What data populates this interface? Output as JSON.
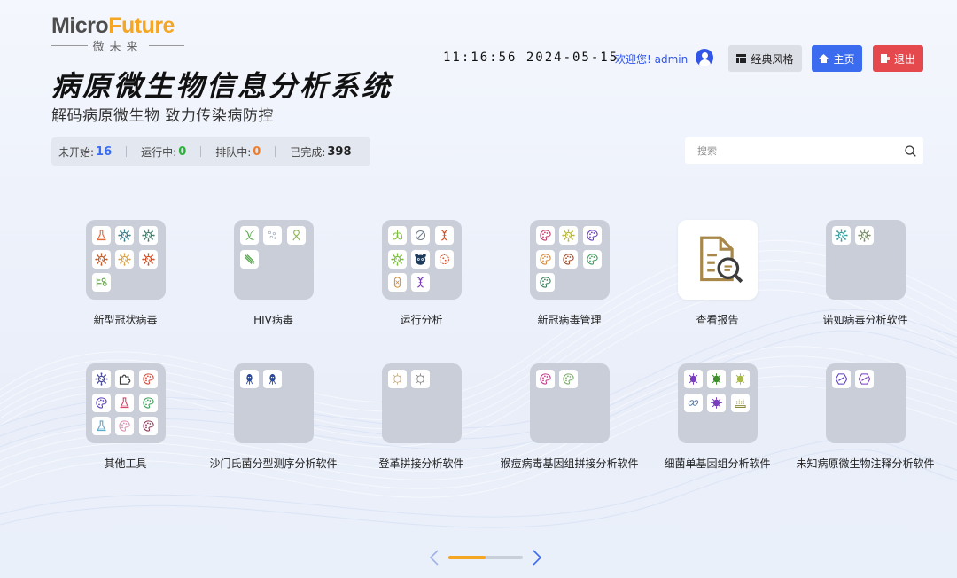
{
  "logo": {
    "brand_part1": "Micro",
    "brand_part2": "Future",
    "subtitle": "微未来"
  },
  "header": {
    "title": "病原微生物信息分析系统",
    "subtitle": "解码病原微生物 致力传染病防控",
    "clock": "11:16:56 2024-05-15",
    "welcome": "欢迎您! admin",
    "buttons": {
      "classic": "经典风格",
      "home": "主页",
      "logout": "退出"
    }
  },
  "status": [
    {
      "label": "未开始:",
      "value": "16",
      "color": "#3b6cf0"
    },
    {
      "label": "运行中:",
      "value": "0",
      "color": "#2bb13a"
    },
    {
      "label": "排队中:",
      "value": "0",
      "color": "#f07c2a"
    },
    {
      "label": "已完成:",
      "value": "398",
      "color": "#222222"
    }
  ],
  "search": {
    "placeholder": "搜索"
  },
  "apps": [
    {
      "label": "新型冠状病毒",
      "type": "folder",
      "icons": [
        {
          "icon": "flask-icon",
          "color": "#e0693c"
        },
        {
          "icon": "virus-icon",
          "color": "#3c7f8c"
        },
        {
          "icon": "virus-icon",
          "color": "#4a7f6b"
        },
        {
          "icon": "virus-icon",
          "color": "#c45c2a"
        },
        {
          "icon": "virus-icon",
          "color": "#d9a54a"
        },
        {
          "icon": "virus-icon",
          "color": "#d0502a"
        },
        {
          "icon": "dna-sample-icon",
          "color": "#6aa84f"
        }
      ]
    },
    {
      "label": "HIV病毒",
      "type": "folder",
      "icons": [
        {
          "icon": "strand-icon",
          "color": "#5aa84f"
        },
        {
          "icon": "dots-icon",
          "color": "#9aa3b8"
        },
        {
          "icon": "ribbon-icon",
          "color": "#8cb84f"
        },
        {
          "icon": "slash-icon",
          "color": "#5aa84f"
        }
      ]
    },
    {
      "label": "运行分析",
      "type": "folder",
      "icons": [
        {
          "icon": "lungs-icon",
          "color": "#7bbf3c"
        },
        {
          "icon": "pill-icon",
          "color": "#6f7b8c"
        },
        {
          "icon": "dna-icon",
          "color": "#d0502a"
        },
        {
          "icon": "virus-icon",
          "color": "#7bbf3c"
        },
        {
          "icon": "panda-icon",
          "color": "#1d3b5a"
        },
        {
          "icon": "cell-icon",
          "color": "#d0502a"
        },
        {
          "icon": "capsule-icon",
          "color": "#d28a3c"
        },
        {
          "icon": "dna-icon",
          "color": "#7b3cbf"
        }
      ]
    },
    {
      "label": "新冠病毒管理",
      "type": "folder",
      "icons": [
        {
          "icon": "palette-icon",
          "color": "#c23c6a"
        },
        {
          "icon": "virus-icon",
          "color": "#b9b93c"
        },
        {
          "icon": "palette-icon",
          "color": "#6a3cbf"
        },
        {
          "icon": "palette-icon",
          "color": "#d28a3c"
        },
        {
          "icon": "palette-icon",
          "color": "#a04a2a"
        },
        {
          "icon": "palette-icon",
          "color": "#3c9f5a"
        },
        {
          "icon": "palette-icon",
          "color": "#3c7f5a"
        }
      ]
    },
    {
      "label": "查看报告",
      "type": "single",
      "icons": [
        {
          "icon": "report-search-icon",
          "color": "#a8884a"
        }
      ]
    },
    {
      "label": "诺如病毒分析软件",
      "type": "folder",
      "icons": [
        {
          "icon": "virus-icon",
          "color": "#3c9f9f"
        },
        {
          "icon": "virus-icon",
          "color": "#7a8f6a"
        }
      ]
    },
    {
      "label": "其他工具",
      "type": "folder",
      "icons": [
        {
          "icon": "virus-icon",
          "color": "#4a4a9f"
        },
        {
          "icon": "puzzle-icon",
          "color": "#3c3c3c"
        },
        {
          "icon": "palette-icon",
          "color": "#d04a3c"
        },
        {
          "icon": "palette-icon",
          "color": "#5a3cbf"
        },
        {
          "icon": "flask-icon",
          "color": "#d04a6a"
        },
        {
          "icon": "palette-icon",
          "color": "#3c9f5a"
        },
        {
          "icon": "flask-icon",
          "color": "#5aaacc"
        },
        {
          "icon": "palette-icon",
          "color": "#e08ab0"
        },
        {
          "icon": "palette-icon",
          "color": "#8a3c5a"
        }
      ]
    },
    {
      "label": "沙门氏菌分型测序分析软件",
      "type": "folder",
      "icons": [
        {
          "icon": "bacteria-icon",
          "color": "#2a4a9f"
        },
        {
          "icon": "bacteria-icon",
          "color": "#2a4a9f"
        }
      ]
    },
    {
      "label": "登革拼接分析软件",
      "type": "folder",
      "icons": [
        {
          "icon": "virus-outline-icon",
          "color": "#c8b08a"
        },
        {
          "icon": "virus-outline-icon",
          "color": "#8a8a8a"
        }
      ]
    },
    {
      "label": "猴痘病毒基因组拼接分析软件",
      "type": "folder",
      "icons": [
        {
          "icon": "palette-icon",
          "color": "#c23c8a"
        },
        {
          "icon": "palette-icon",
          "color": "#7aaa6a"
        }
      ]
    },
    {
      "label": "细菌单基因组分析软件",
      "type": "folder",
      "icons": [
        {
          "icon": "microbe-icon",
          "color": "#7b3cbf"
        },
        {
          "icon": "microbe-icon",
          "color": "#3c8f2a"
        },
        {
          "icon": "microbe-icon",
          "color": "#a8b84a"
        },
        {
          "icon": "link-icon",
          "color": "#5a7a9f"
        },
        {
          "icon": "microbe-icon",
          "color": "#7b3cbf"
        },
        {
          "icon": "tray-icon",
          "color": "#8a8a3c"
        }
      ]
    },
    {
      "label": "未知病原微生物注释分析软件",
      "type": "folder",
      "icons": [
        {
          "icon": "hexagon-icon",
          "color": "#5a3cbf"
        },
        {
          "icon": "hexagon-icon",
          "color": "#7b3cbf"
        }
      ]
    }
  ],
  "pager": {
    "progress": 0.5,
    "accent": "#f5a623"
  }
}
